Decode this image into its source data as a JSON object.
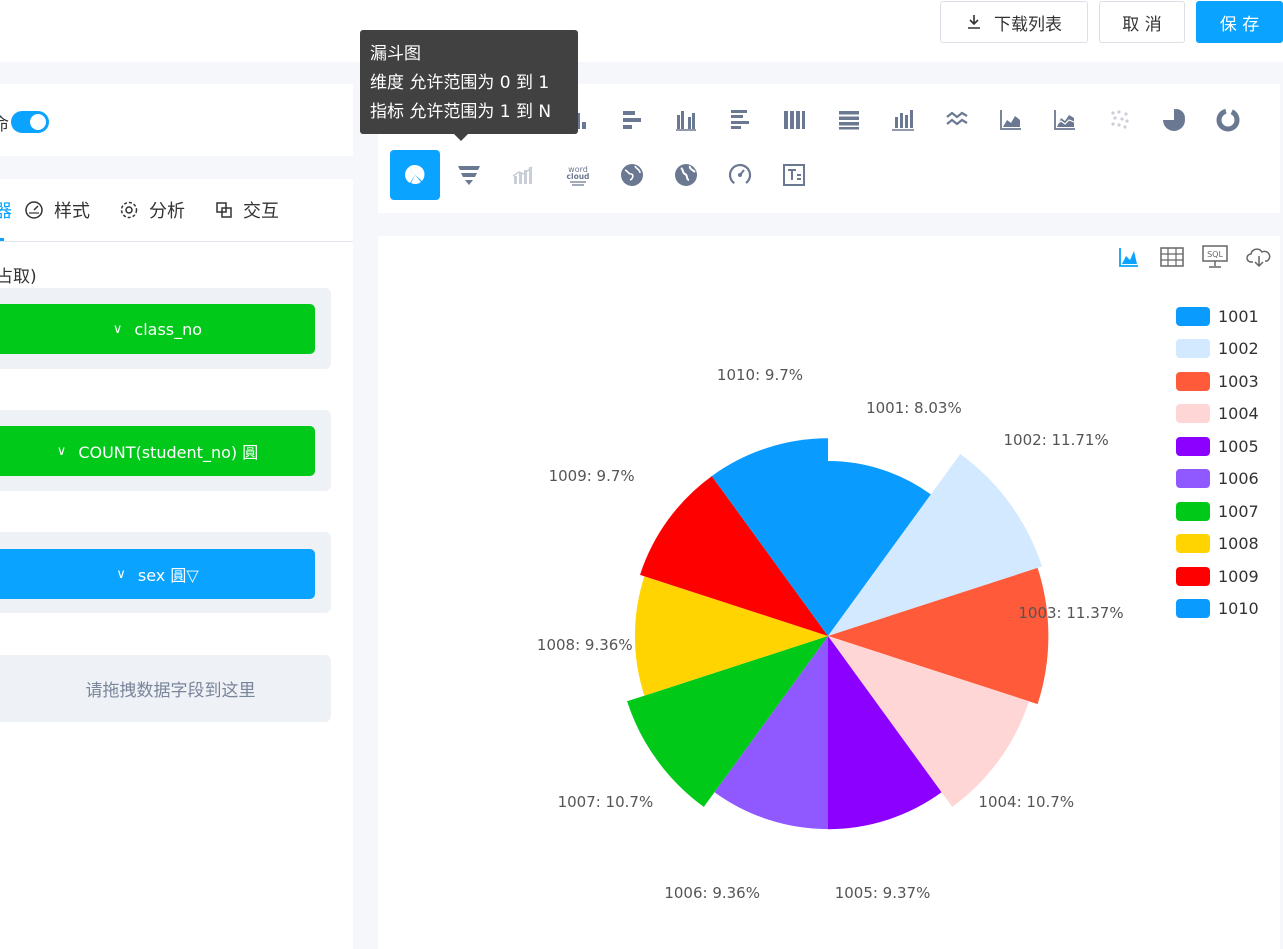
{
  "toolbar": {
    "download_label": "下载列表",
    "cancel_label": "取 消",
    "save_label": "保 存"
  },
  "left": {
    "toggle_label_fragment": "命",
    "tabs": [
      {
        "label": "器",
        "icon": "bar-indicator"
      },
      {
        "label": "样式",
        "icon": "gauge-icon"
      },
      {
        "label": "分析",
        "icon": "gear-icon"
      },
      {
        "label": "交互",
        "icon": "copy-icon"
      }
    ],
    "section_label": "占取)",
    "fields": [
      {
        "label": "class_no",
        "color": "#00c91a"
      },
      {
        "label": "COUNT(student_no) 圓",
        "color": "#00c91a"
      },
      {
        "label": "sex 圓▽",
        "color": "#0aa3ff"
      }
    ],
    "drop_placeholder": "请拖拽数据字段到这里"
  },
  "tooltip": {
    "title": "漏斗图",
    "line1": "维度 允许范围为 0 到 1",
    "line2": "指标 允许范围为 1 到 N"
  },
  "chart_types": {
    "row1": [
      "table-icon",
      "cross-table-icon",
      "detail-icon",
      "column-icon",
      "bar-icon",
      "grouped-column-icon",
      "grouped-bar-icon",
      "stacked-column-icon",
      "stacked-bar-icon",
      "combo-icon",
      "line-icon",
      "area-icon",
      "stacked-area-icon",
      "scatter-icon",
      "pie-icon",
      "donut-icon"
    ],
    "row2": [
      "rose-pie-icon",
      "funnel-icon",
      "bar-line-icon",
      "word-cloud-icon",
      "globe-icon",
      "map-icon",
      "gauge-chart-icon",
      "text-card-icon"
    ],
    "selected": "rose-pie-icon",
    "word_cloud_text": "word cloud"
  },
  "chart_actions": [
    "chart-view-icon",
    "table-view-icon",
    "sql-icon",
    "cloud-download-icon"
  ],
  "chart_actions_text": {
    "sql": "SQL"
  },
  "chart_data": {
    "type": "pie",
    "variant": "rose",
    "slices": [
      {
        "name": "1001",
        "percent": 8.03,
        "color": "#0a9bff",
        "label": "1001: 8.03%"
      },
      {
        "name": "1002",
        "percent": 11.71,
        "color": "#d3e9ff",
        "label": "1002: 11.71%"
      },
      {
        "name": "1003",
        "percent": 11.37,
        "color": "#ff5a3a",
        "label": "1003: 11.37%"
      },
      {
        "name": "1004",
        "percent": 10.7,
        "color": "#ffd6d6",
        "label": "1004: 10.7%"
      },
      {
        "name": "1005",
        "percent": 9.37,
        "color": "#8c00ff",
        "label": "1005: 9.37%"
      },
      {
        "name": "1006",
        "percent": 9.36,
        "color": "#9058ff",
        "label": "1006: 9.36%"
      },
      {
        "name": "1007",
        "percent": 10.7,
        "color": "#00c918",
        "label": "1007: 10.7%"
      },
      {
        "name": "1008",
        "percent": 9.36,
        "color": "#ffd400",
        "label": "1008: 9.36%"
      },
      {
        "name": "1009",
        "percent": 9.7,
        "color": "#ff0000",
        "label": "1009: 9.7%"
      },
      {
        "name": "1010",
        "percent": 9.7,
        "color": "#0a9bff",
        "label": "1010: 9.7%"
      }
    ],
    "legend_position": "right"
  }
}
